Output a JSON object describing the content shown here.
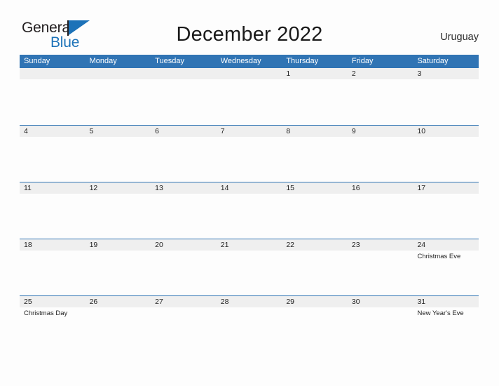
{
  "brand": {
    "name_part1": "General",
    "name_part2": "Blue",
    "flag_icon": "blue-flag-triangle"
  },
  "header": {
    "title": "December 2022",
    "country": "Uruguay"
  },
  "calendar": {
    "weekdays": [
      "Sunday",
      "Monday",
      "Tuesday",
      "Wednesday",
      "Thursday",
      "Friday",
      "Saturday"
    ],
    "accent_color": "#3074B4",
    "band_color": "#EFEFEF",
    "weeks": [
      {
        "days": [
          {
            "num": "",
            "event": ""
          },
          {
            "num": "",
            "event": ""
          },
          {
            "num": "",
            "event": ""
          },
          {
            "num": "",
            "event": ""
          },
          {
            "num": "1",
            "event": ""
          },
          {
            "num": "2",
            "event": ""
          },
          {
            "num": "3",
            "event": ""
          }
        ]
      },
      {
        "days": [
          {
            "num": "4",
            "event": ""
          },
          {
            "num": "5",
            "event": ""
          },
          {
            "num": "6",
            "event": ""
          },
          {
            "num": "7",
            "event": ""
          },
          {
            "num": "8",
            "event": ""
          },
          {
            "num": "9",
            "event": ""
          },
          {
            "num": "10",
            "event": ""
          }
        ]
      },
      {
        "days": [
          {
            "num": "11",
            "event": ""
          },
          {
            "num": "12",
            "event": ""
          },
          {
            "num": "13",
            "event": ""
          },
          {
            "num": "14",
            "event": ""
          },
          {
            "num": "15",
            "event": ""
          },
          {
            "num": "16",
            "event": ""
          },
          {
            "num": "17",
            "event": ""
          }
        ]
      },
      {
        "days": [
          {
            "num": "18",
            "event": ""
          },
          {
            "num": "19",
            "event": ""
          },
          {
            "num": "20",
            "event": ""
          },
          {
            "num": "21",
            "event": ""
          },
          {
            "num": "22",
            "event": ""
          },
          {
            "num": "23",
            "event": ""
          },
          {
            "num": "24",
            "event": "Christmas Eve"
          }
        ]
      },
      {
        "days": [
          {
            "num": "25",
            "event": "Christmas Day"
          },
          {
            "num": "26",
            "event": ""
          },
          {
            "num": "27",
            "event": ""
          },
          {
            "num": "28",
            "event": ""
          },
          {
            "num": "29",
            "event": ""
          },
          {
            "num": "30",
            "event": ""
          },
          {
            "num": "31",
            "event": "New Year's Eve"
          }
        ]
      }
    ]
  }
}
